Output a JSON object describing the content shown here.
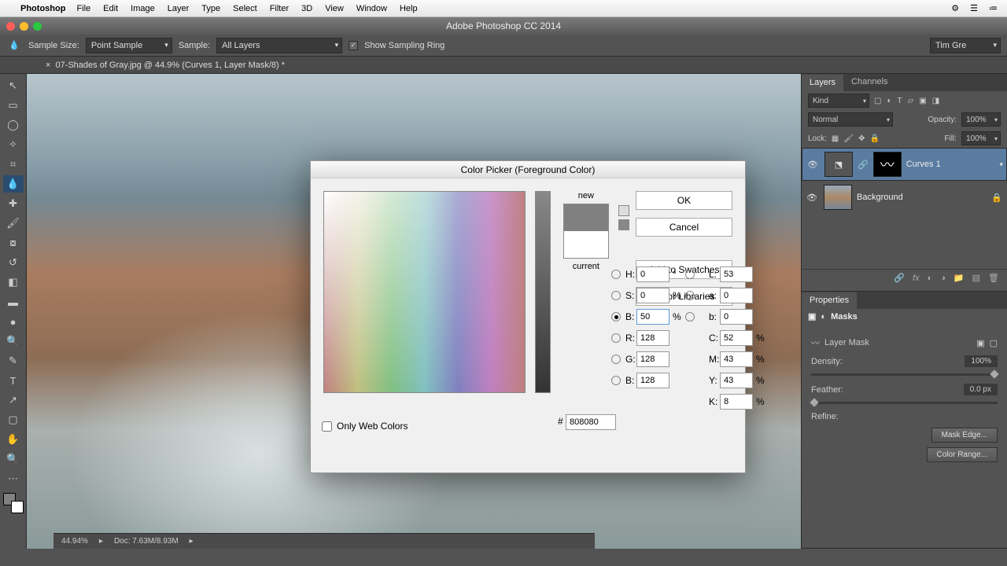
{
  "mac_menu": {
    "appname": "Photoshop",
    "items": [
      "File",
      "Edit",
      "Image",
      "Layer",
      "Type",
      "Select",
      "Filter",
      "3D",
      "View",
      "Window",
      "Help"
    ]
  },
  "titlebar": {
    "title": "Adobe Photoshop CC 2014"
  },
  "options": {
    "sample_size_label": "Sample Size:",
    "sample_size_value": "Point Sample",
    "sample_label": "Sample:",
    "sample_value": "All Layers",
    "show_ring": "Show Sampling Ring",
    "workspace": "Tim Gre"
  },
  "doctab": "07-Shades of Gray.jpg @ 44.9% (Curves 1, Layer Mask/8) *",
  "layers": {
    "tab1": "Layers",
    "tab2": "Channels",
    "kind": "Kind",
    "blend": "Normal",
    "opacity_label": "Opacity:",
    "opacity": "100%",
    "lock_label": "Lock:",
    "fill_label": "Fill:",
    "fill": "100%",
    "layer1": "Curves 1",
    "layer2": "Background"
  },
  "properties": {
    "tab": "Properties",
    "type": "Masks",
    "mask_type": "Layer Mask",
    "density_label": "Density:",
    "density": "100%",
    "feather_label": "Feather:",
    "feather": "0.0 px",
    "refine_label": "Refine:",
    "mask_edge_btn": "Mask Edge...",
    "color_range_btn": "Color Range..."
  },
  "picker": {
    "title": "Color Picker (Foreground Color)",
    "new": "new",
    "current": "current",
    "ok": "OK",
    "cancel": "Cancel",
    "swatches": "Add to Swatches",
    "libraries": "Color Libraries",
    "owc": "Only Web Colors",
    "H": "0",
    "S": "0",
    "B_hsb": "50",
    "L": "53",
    "a": "0",
    "b_lab": "0",
    "R": "128",
    "G": "128",
    "B_rgb": "128",
    "C": "52",
    "M": "43",
    "Y": "43",
    "K": "8",
    "hex": "808080",
    "H_lbl": "H:",
    "S_lbl": "S:",
    "B_hsb_lbl": "B:",
    "L_lbl": "L:",
    "a_lbl": "a:",
    "b_lab_lbl": "b:",
    "R_lbl": "R:",
    "G_lbl": "G:",
    "B_rgb_lbl": "B:",
    "C_lbl": "C:",
    "M_lbl": "M:",
    "Y_lbl": "Y:",
    "K_lbl": "K:",
    "deg": "°",
    "pct": "%",
    "hash": "#"
  },
  "status": {
    "zoom": "44.94%",
    "doc": "Doc: 7.63M/8.93M"
  }
}
